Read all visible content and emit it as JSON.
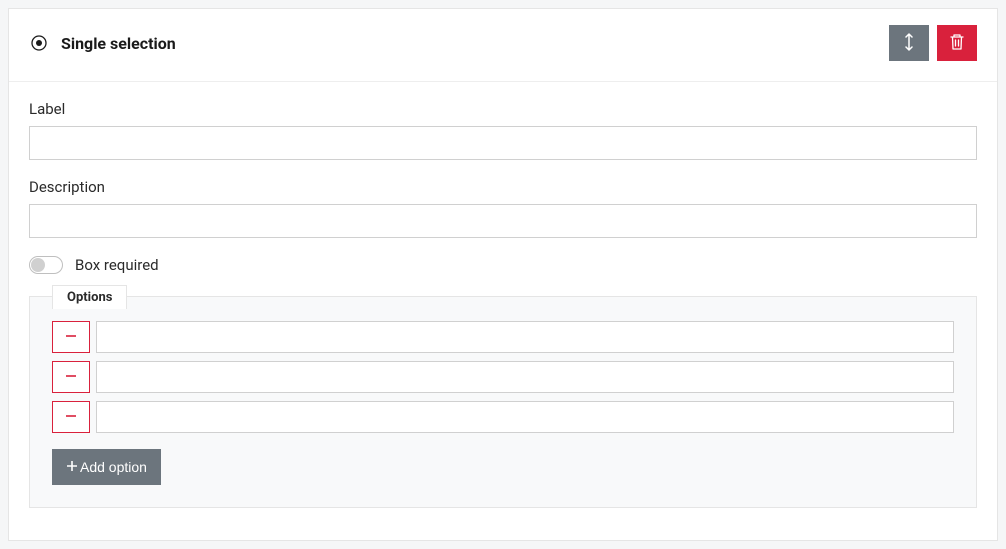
{
  "header": {
    "title": "Single selection"
  },
  "fields": {
    "label": {
      "label": "Label",
      "value": ""
    },
    "description": {
      "label": "Description",
      "value": ""
    },
    "required": {
      "label": "Box required",
      "checked": false
    }
  },
  "options": {
    "title": "Options",
    "items": [
      {
        "value": ""
      },
      {
        "value": ""
      },
      {
        "value": ""
      }
    ],
    "add_label": "Add option"
  },
  "colors": {
    "danger": "#d9213c",
    "gray": "#6c757d"
  }
}
